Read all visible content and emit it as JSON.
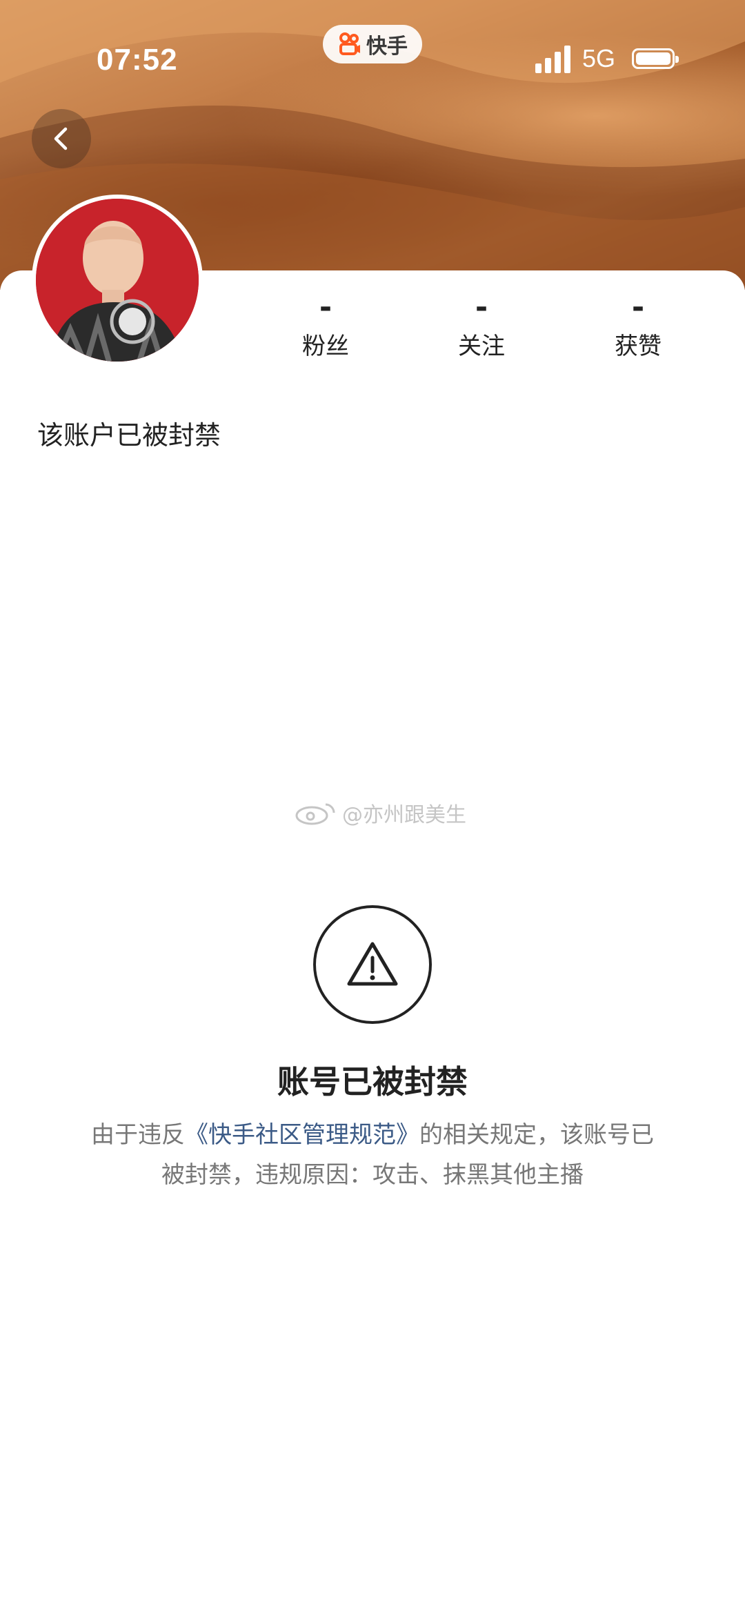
{
  "status_bar": {
    "time": "07:52",
    "app_badge": "快手",
    "network": "5G",
    "signal_icon": "cellular-signal-icon",
    "battery_icon": "battery-icon"
  },
  "header": {
    "back_icon": "chevron-left-icon"
  },
  "profile": {
    "stats": [
      {
        "value": "-",
        "label": "粉丝"
      },
      {
        "value": "-",
        "label": "关注"
      },
      {
        "value": "-",
        "label": "获赞"
      }
    ],
    "bio": "该账户已被封禁"
  },
  "watermark": "@亦州跟美生",
  "ban_notice": {
    "icon": "warning-triangle-icon",
    "title": "账号已被封禁",
    "desc_prefix": "由于违反",
    "desc_link": "《快手社区管理规范》",
    "desc_suffix": "的相关规定，该账号已被封禁，违规原因：攻击、抹黑其他主播"
  },
  "colors": {
    "link": "#3b5a86",
    "banner": "#b06a36",
    "avatar_bg": "#c8232b"
  }
}
